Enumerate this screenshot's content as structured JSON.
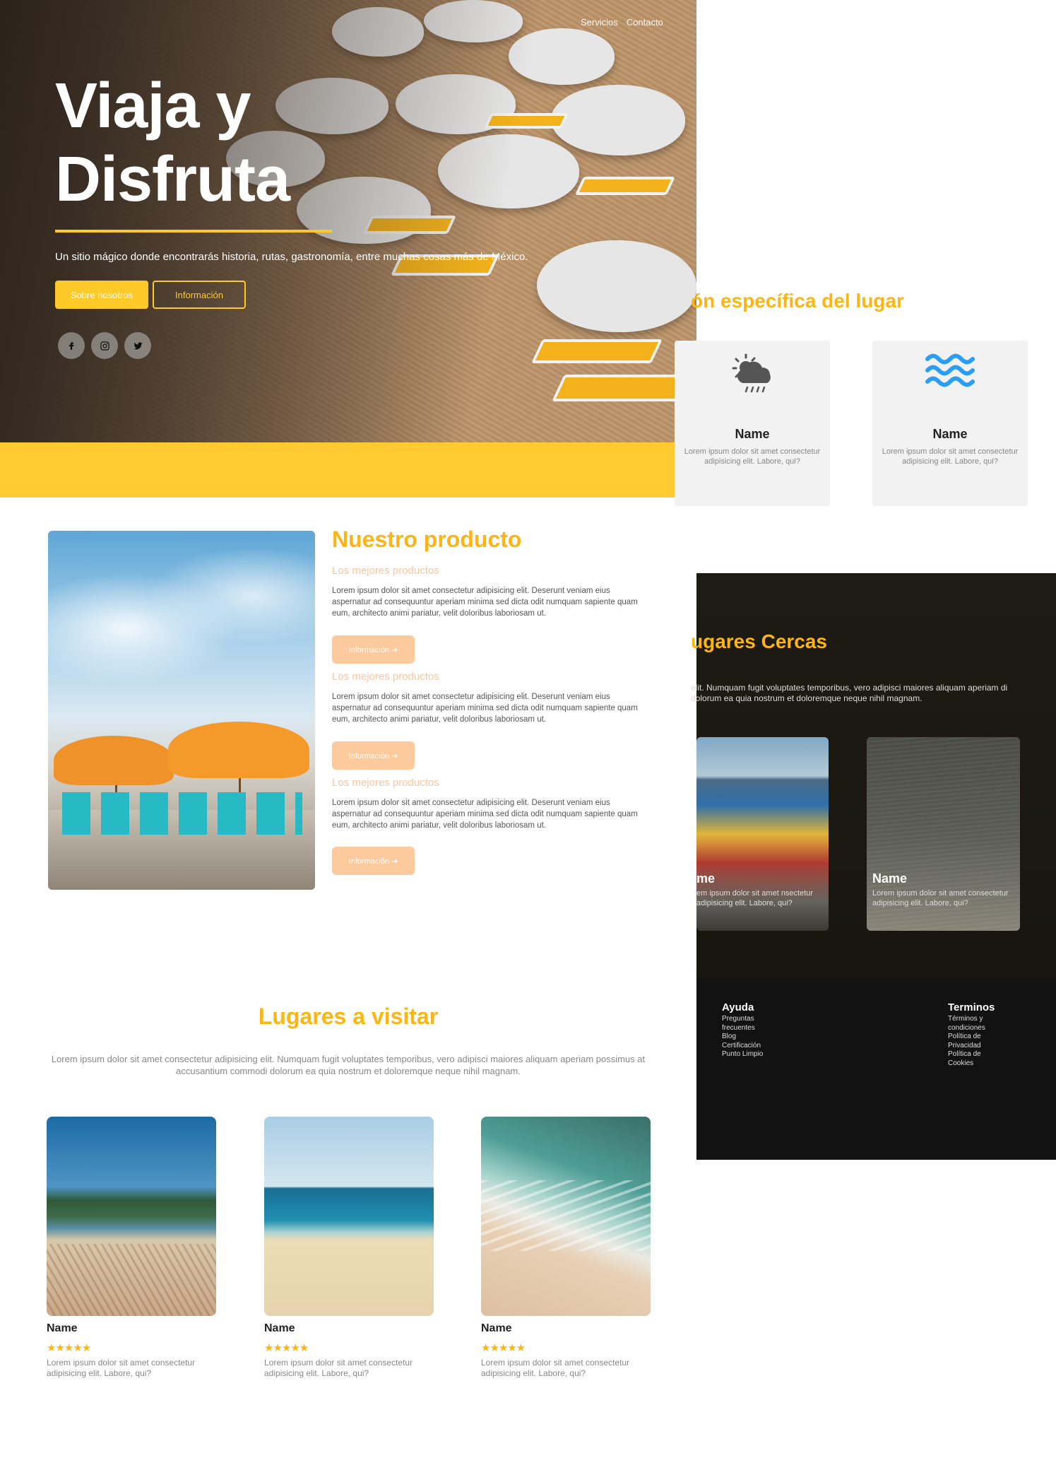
{
  "nav": {
    "items": [
      "Servicios",
      "Contacto"
    ]
  },
  "hero": {
    "title_line1": "Viaja y",
    "title_line2": "Disfruta",
    "subtitle": "Un sitio mágico donde encontrarás historia, rutas, gastronomía, entre muchas cosas más de México.",
    "btn_about": "Sobre nosotros",
    "btn_info": "Información",
    "social_icons": [
      "facebook-icon",
      "instagram-icon",
      "twitter-icon"
    ]
  },
  "specific": {
    "title": "ón específica del lugar",
    "cards": [
      {
        "icon": "partly-cloudy-rain-icon",
        "name": "Name",
        "desc": "Lorem ipsum dolor sit amet consectetur adipisicing elit. Labore, qui?"
      },
      {
        "icon": "waves-icon",
        "name": "Name",
        "desc": "Lorem ipsum dolor sit amet consectetur adipisicing elit. Labore, qui?"
      }
    ]
  },
  "product": {
    "title": "Nuestro producto",
    "items": [
      {
        "subtitle": "Los mejores productos",
        "desc": "Lorem ipsum dolor sit amet consectetur adipisicing elit. Deserunt veniam eius aspernatur ad consequuntur aperiam minima sed dicta odit numquam sapiente quam eum, architecto animi pariatur, velit doloribus laboriosam ut.",
        "btn": "Información ➔"
      },
      {
        "subtitle": "Los mejores productos",
        "desc": "Lorem ipsum dolor sit amet consectetur adipisicing elit. Deserunt veniam eius aspernatur ad consequuntur aperiam minima sed dicta odit numquam sapiente quam eum, architecto animi pariatur, velit doloribus laboriosam ut.",
        "btn": "Información ➔"
      },
      {
        "subtitle": "Los mejores productos",
        "desc": "Lorem ipsum dolor sit amet consectetur adipisicing elit. Deserunt veniam eius aspernatur ad consequuntur aperiam minima sed dicta odit numquam sapiente quam eum, architecto animi pariatur, velit doloribus laboriosam ut.",
        "btn": "Información ➔"
      }
    ]
  },
  "cercas": {
    "title": "ugares Cercas",
    "desc": "elit. Numquam fugit voluptates temporibus, vero adipisci maiores aliquam aperiam di dolorum ea quia nostrum et doloremque neque nihil magnam.",
    "cards": [
      {
        "name": "me",
        "desc": "em ipsum dolor sit amet nsectetur adipisicing elit. Labore, qui?"
      },
      {
        "name": "Name",
        "desc": "Lorem ipsum dolor sit amet consectetur adipisicing elit. Labore, qui?"
      }
    ]
  },
  "footer": {
    "col1": {
      "title": "Ayuda",
      "links": [
        "Preguntas frecuentes",
        "Blog",
        "Certificación",
        "Punto Limpio"
      ]
    },
    "col2": {
      "title": "Terminos",
      "links": [
        "Términos y condiciones",
        "Política de Privacidad",
        "Política de Cookies"
      ]
    }
  },
  "visit": {
    "title": "Lugares a visitar",
    "desc": "Lorem ipsum dolor sit amet consectetur adipisicing elit. Numquam fugit voluptates temporibus, vero adipisci maiores aliquam aperiam possimus at accusantium commodi dolorum ea quia nostrum et doloremque neque nihil magnam.",
    "cards": [
      {
        "name": "Name",
        "stars": "★★★★★",
        "desc": "Lorem ipsum dolor sit amet consectetur adipisicing elit. Labore, qui?"
      },
      {
        "name": "Name",
        "stars": "★★★★★",
        "desc": "Lorem ipsum dolor sit amet consectetur adipisicing elit. Labore, qui?"
      },
      {
        "name": "Name",
        "stars": "★★★★★",
        "desc": "Lorem ipsum dolor sit amet consectetur adipisicing elit. Labore, qui?"
      }
    ]
  },
  "colors": {
    "accent": "#fbb615",
    "band": "#ffcb31",
    "button_soft": "#fcca9c",
    "footer_bg": "#121212"
  }
}
